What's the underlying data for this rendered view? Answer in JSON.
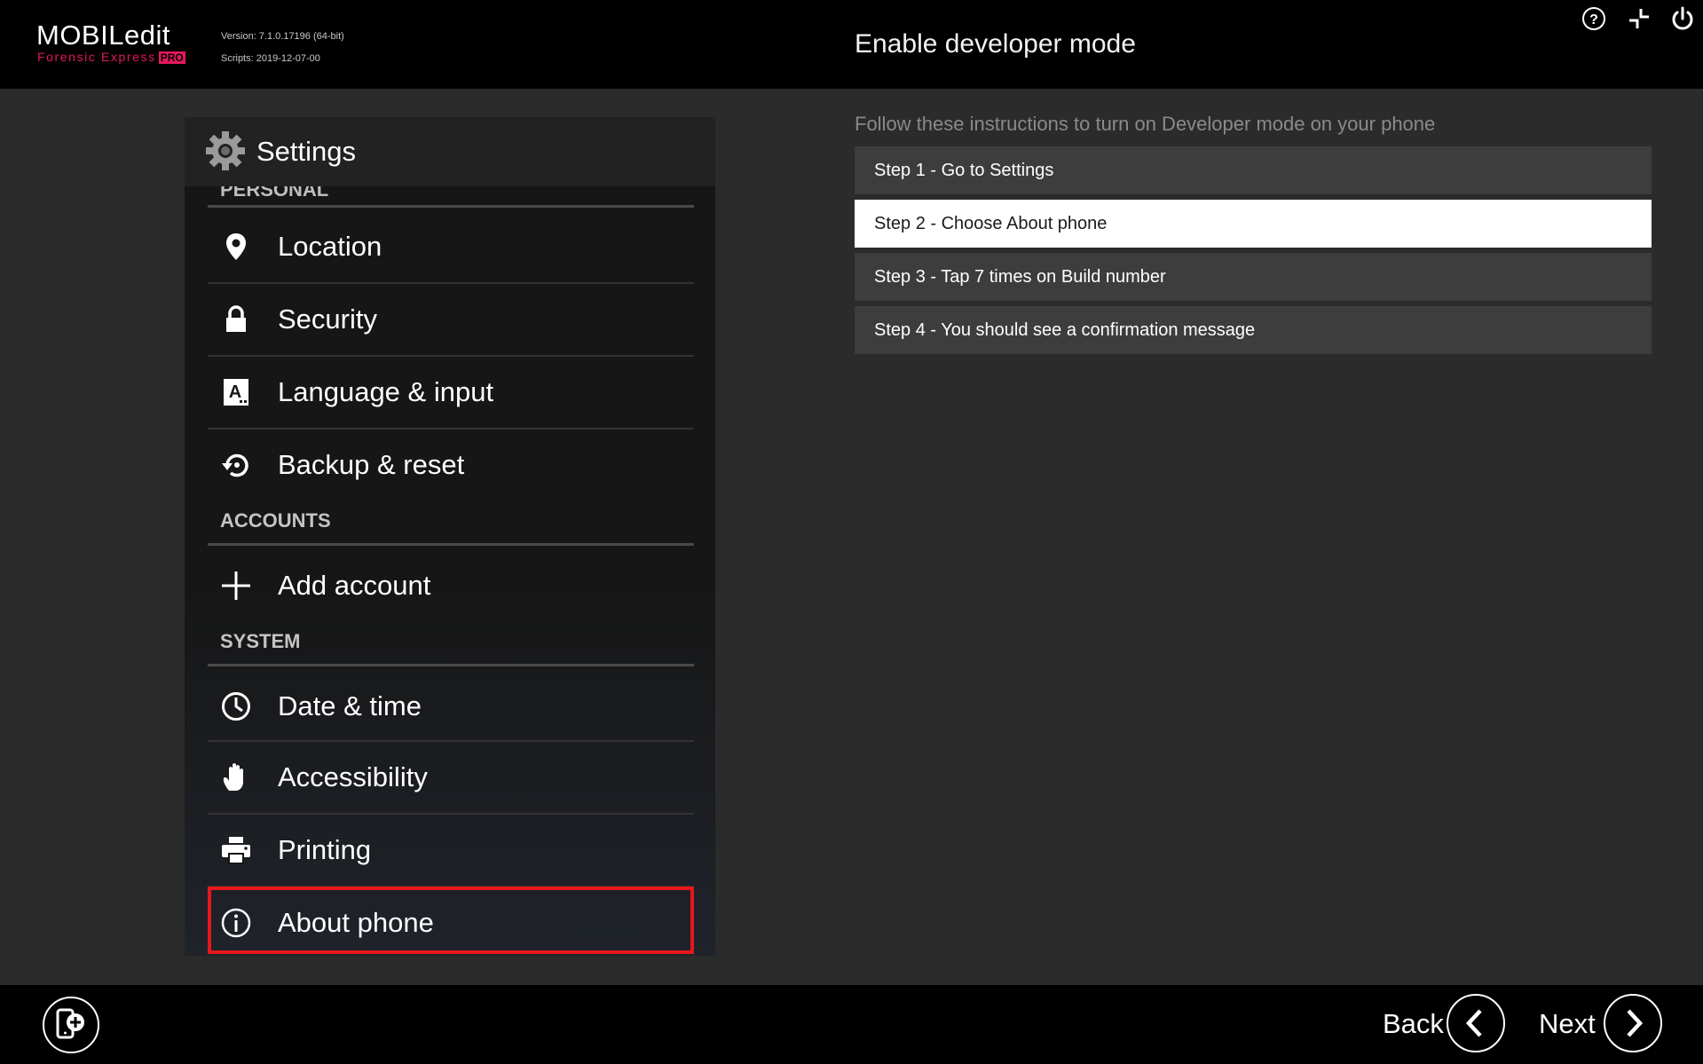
{
  "app": {
    "logo_main": "MOBILedit",
    "logo_sub": "Forensic Express",
    "logo_badge": "PRO",
    "version": "Version: 7.1.0.17196 (64-bit)",
    "scripts": "Scripts: 2019-12-07-00"
  },
  "page": {
    "title": "Enable developer mode",
    "instructions": "Follow these instructions to turn on Developer mode on your phone"
  },
  "top_icons": [
    "help-icon",
    "minimize-icon",
    "power-icon"
  ],
  "phone_screenshot": {
    "header_title": "Settings",
    "section_personal": "PERSONAL",
    "personal_items": [
      {
        "label": "Location",
        "icon": "location-pin-icon"
      },
      {
        "label": "Security",
        "icon": "lock-icon"
      },
      {
        "label": "Language & input",
        "icon": "keyboard-a-icon"
      },
      {
        "label": "Backup & reset",
        "icon": "backup-restore-icon"
      }
    ],
    "section_accounts": "ACCOUNTS",
    "account_items": [
      {
        "label": "Add account",
        "icon": "plus-icon"
      }
    ],
    "section_system": "SYSTEM",
    "system_items": [
      {
        "label": "Date & time",
        "icon": "clock-icon"
      },
      {
        "label": "Accessibility",
        "icon": "hand-icon"
      },
      {
        "label": "Printing",
        "icon": "printer-icon"
      },
      {
        "label": "About phone",
        "icon": "info-icon",
        "highlighted": true
      }
    ],
    "highlight_color": "#e8161f"
  },
  "steps": [
    {
      "label": "Step 1 - Go to Settings",
      "active": false
    },
    {
      "label": "Step 2 - Choose About phone",
      "active": true
    },
    {
      "label": "Step 3 - Tap 7 times on Build number",
      "active": false
    },
    {
      "label": "Step 4 - You should see a confirmation message",
      "active": false
    }
  ],
  "footer": {
    "back_label": "Back",
    "next_label": "Next"
  },
  "colors": {
    "brand_accent": "#e5185d",
    "background": "#2b2b2b",
    "bar": "#000000",
    "step_bg": "#3d3d3d",
    "step_active_bg": "#ffffff"
  }
}
